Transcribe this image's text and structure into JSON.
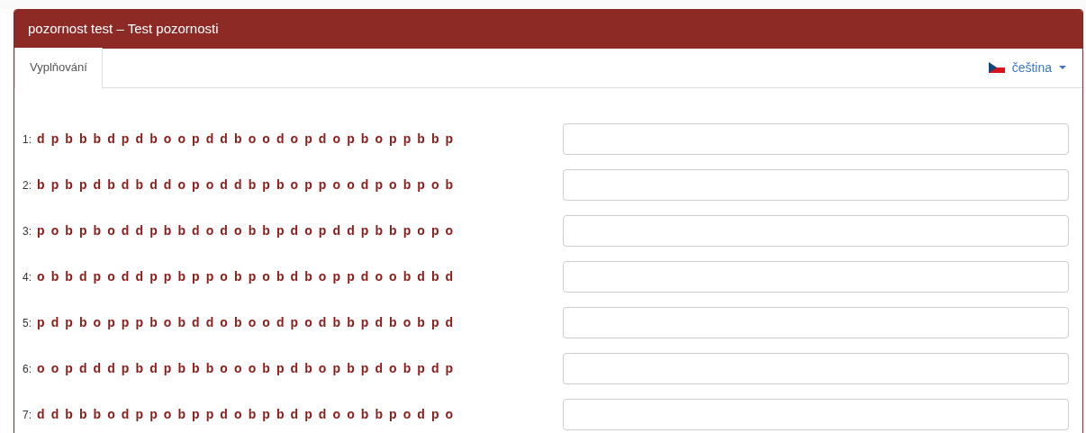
{
  "panel": {
    "title": "pozornost test – Test pozornosti"
  },
  "tabs": [
    {
      "label": "Vyplňování",
      "selected": true
    }
  ],
  "language": {
    "label": "čeština"
  },
  "rows": [
    {
      "number": "1:",
      "letters": "d p b b b d p d b o o p d d b o o d o p d o p b o p p b b p"
    },
    {
      "number": "2:",
      "letters": "b p b p d b d b d d o p o d d b p b o p p o o d p o b p o b"
    },
    {
      "number": "3:",
      "letters": "p o b p b o d d p b b d o d o b b p d o p d d p b b p o p o"
    },
    {
      "number": "4:",
      "letters": "o b b d p o d d p p b p p o b p o b d b o p p d o o b d b d"
    },
    {
      "number": "5:",
      "letters": "p d p b o p p p b o b d d o b o o d p o d b b p d b o b p d"
    },
    {
      "number": "6:",
      "letters": "o o p d d d p b d p b b b o o o b p d b o p b p d o b p d p"
    },
    {
      "number": "7:",
      "letters": "d d b b b o d p p o b p p d o b p b d p d o o b b p o d p o"
    }
  ]
}
